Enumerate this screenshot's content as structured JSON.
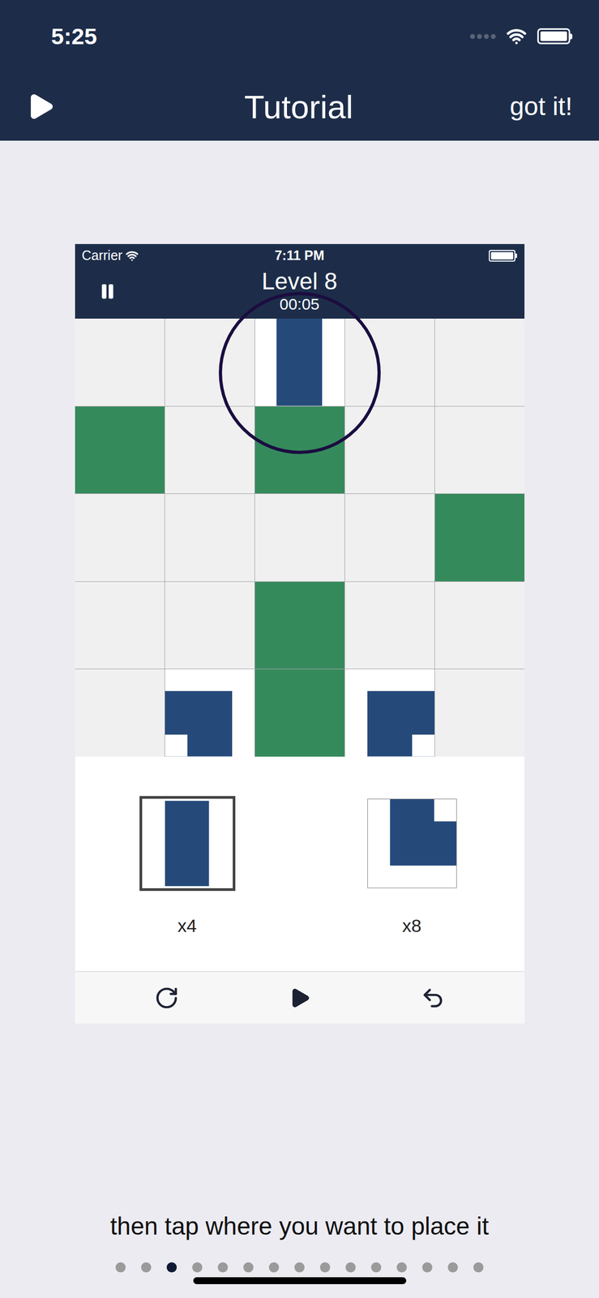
{
  "status_bar": {
    "time": "5:25"
  },
  "nav": {
    "title": "Tutorial",
    "action": "got it!"
  },
  "preview": {
    "status_bar": {
      "carrier": "Carrier",
      "time": "7:11 PM"
    },
    "title": "Level 8",
    "timer": "00:05",
    "highlight": {
      "row": 0,
      "col": 2
    },
    "grid": [
      [
        {
          "kind": "empty"
        },
        {
          "kind": "empty"
        },
        {
          "kind": "bar"
        },
        {
          "kind": "empty"
        },
        {
          "kind": "empty"
        }
      ],
      [
        {
          "kind": "green"
        },
        {
          "kind": "empty"
        },
        {
          "kind": "green"
        },
        {
          "kind": "empty"
        },
        {
          "kind": "empty"
        }
      ],
      [
        {
          "kind": "empty"
        },
        {
          "kind": "empty"
        },
        {
          "kind": "empty"
        },
        {
          "kind": "empty"
        },
        {
          "kind": "green"
        }
      ],
      [
        {
          "kind": "empty"
        },
        {
          "kind": "empty"
        },
        {
          "kind": "green"
        },
        {
          "kind": "empty"
        },
        {
          "kind": "empty"
        }
      ],
      [
        {
          "kind": "empty"
        },
        {
          "kind": "corner",
          "notch": "bottom-left"
        },
        {
          "kind": "green"
        },
        {
          "kind": "corner",
          "notch": "bottom-right"
        },
        {
          "kind": "empty"
        }
      ]
    ],
    "pieces": [
      {
        "kind": "bar",
        "count": "x4",
        "selected": true
      },
      {
        "kind": "corner",
        "notch": "top-right",
        "count": "x8",
        "selected": false
      }
    ]
  },
  "caption": "then tap where you want to place it",
  "pages": [
    {
      "selected": false
    },
    {
      "selected": false
    },
    {
      "selected": true
    },
    {
      "selected": false
    },
    {
      "selected": false
    },
    {
      "selected": false
    },
    {
      "selected": false
    },
    {
      "selected": false
    },
    {
      "selected": false
    },
    {
      "selected": false
    },
    {
      "selected": false
    },
    {
      "selected": false
    },
    {
      "selected": false
    },
    {
      "selected": false
    },
    {
      "selected": false
    }
  ]
}
